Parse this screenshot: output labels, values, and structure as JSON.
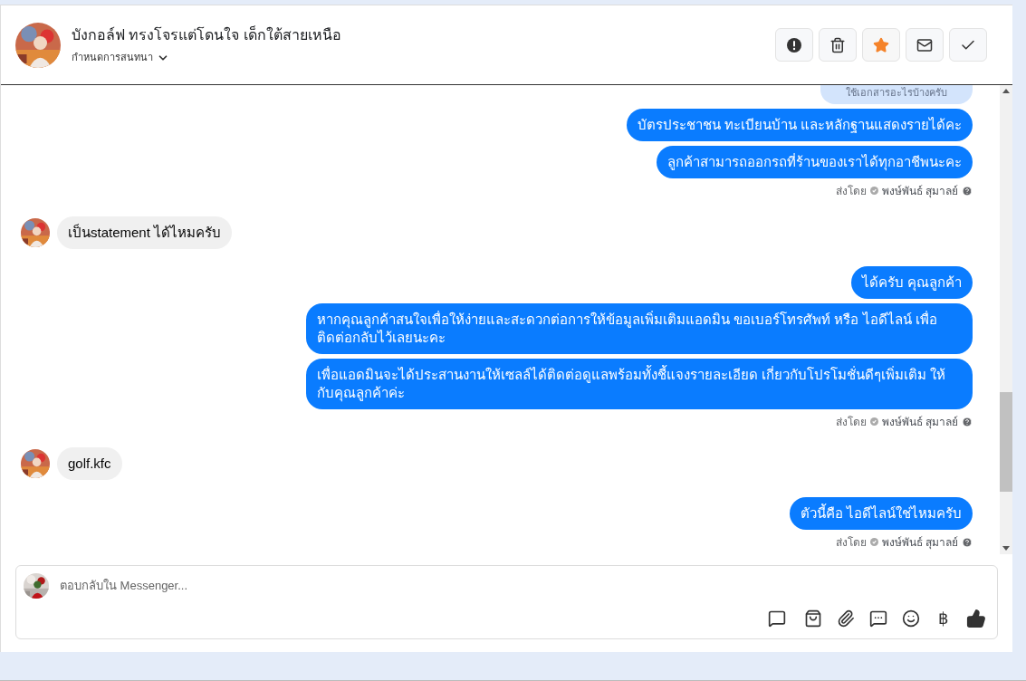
{
  "header": {
    "name": "บังกอล์ฟ ทรงโจรแต่โดนใจ เด็กใต้สายเหนือ",
    "subtitle": "กำหนดการสนทนา",
    "actions": [
      {
        "kind": "alert",
        "on": false
      },
      {
        "kind": "trash",
        "on": false
      },
      {
        "kind": "star",
        "on": true
      },
      {
        "kind": "mail",
        "on": false
      },
      {
        "kind": "check",
        "on": false
      }
    ]
  },
  "messages": [
    {
      "kind": "quoted",
      "text": "ใช้เอกสารอะไรบ้างครับ"
    },
    {
      "kind": "outgoing",
      "text": "บัตรประชาชน ทะเบียนบ้าน และหลักฐานแสดงรายได้คะ"
    },
    {
      "kind": "outgoing",
      "text": "ลูกค้าสามารถออกรถที่ร้านของเราได้ทุกอาชีพนะคะ"
    },
    {
      "kind": "sent_by",
      "label": "ส่งโดย",
      "sender": "พงษ์พันธ์ สุมาลย์"
    },
    {
      "kind": "incoming",
      "text": "เป็นstatement ได้ไหมครับ"
    },
    {
      "kind": "outgoing",
      "text": "ได้ครับ คุณลูกค้า"
    },
    {
      "kind": "outgoing",
      "text": "หากคุณลูกค้าสนใจเพื่อให้ง่ายและสะดวกต่อการให้ข้อมูลเพิ่มเติมแอดมิน ขอเบอร์โทรศัพท์ หรือ ไอดีไลน์ เพื่อติดต่อกลับไว้เลยนะคะ"
    },
    {
      "kind": "outgoing",
      "text": "เพื่อแอดมินจะได้ประสานงานให้เซลล์ได้ติดต่อดูแลพร้อมทั้งชี้แจงรายละเอียด เกี่ยวกับโปรโมชั่นดีๆเพิ่มเติม ให้กับคุณลูกค้าค่ะ"
    },
    {
      "kind": "sent_by",
      "label": "ส่งโดย",
      "sender": "พงษ์พันธ์ สุมาลย์"
    },
    {
      "kind": "incoming",
      "text": "golf.kfc"
    },
    {
      "kind": "outgoing",
      "text": "ตัวนี้คือ ไอดีไลน์ใช่ไหมครับ"
    },
    {
      "kind": "sent_by",
      "label": "ส่งโดย",
      "sender": "พงษ์พันธ์ สุมาลย์"
    }
  ],
  "composer": {
    "placeholder": "ตอบกลับใน Messenger...",
    "tools": [
      {
        "kind": "saved_reply"
      },
      {
        "kind": "shop"
      },
      {
        "kind": "attach"
      },
      {
        "kind": "chat"
      },
      {
        "kind": "emoji"
      },
      {
        "kind": "text",
        "text": "฿"
      },
      {
        "kind": "like"
      }
    ]
  }
}
